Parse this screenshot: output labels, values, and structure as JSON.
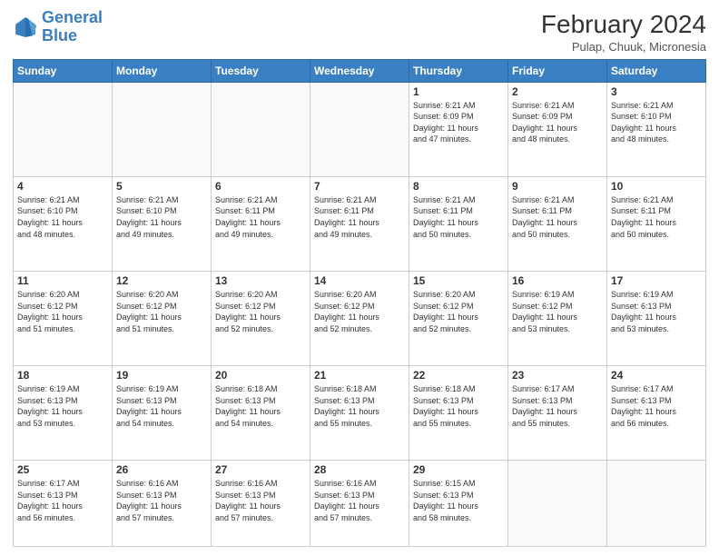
{
  "header": {
    "logo_line1": "General",
    "logo_line2": "Blue",
    "month": "February 2024",
    "location": "Pulap, Chuuk, Micronesia"
  },
  "weekdays": [
    "Sunday",
    "Monday",
    "Tuesday",
    "Wednesday",
    "Thursday",
    "Friday",
    "Saturday"
  ],
  "weeks": [
    [
      {
        "day": "",
        "info": ""
      },
      {
        "day": "",
        "info": ""
      },
      {
        "day": "",
        "info": ""
      },
      {
        "day": "",
        "info": ""
      },
      {
        "day": "1",
        "info": "Sunrise: 6:21 AM\nSunset: 6:09 PM\nDaylight: 11 hours\nand 47 minutes."
      },
      {
        "day": "2",
        "info": "Sunrise: 6:21 AM\nSunset: 6:09 PM\nDaylight: 11 hours\nand 48 minutes."
      },
      {
        "day": "3",
        "info": "Sunrise: 6:21 AM\nSunset: 6:10 PM\nDaylight: 11 hours\nand 48 minutes."
      }
    ],
    [
      {
        "day": "4",
        "info": "Sunrise: 6:21 AM\nSunset: 6:10 PM\nDaylight: 11 hours\nand 48 minutes."
      },
      {
        "day": "5",
        "info": "Sunrise: 6:21 AM\nSunset: 6:10 PM\nDaylight: 11 hours\nand 49 minutes."
      },
      {
        "day": "6",
        "info": "Sunrise: 6:21 AM\nSunset: 6:11 PM\nDaylight: 11 hours\nand 49 minutes."
      },
      {
        "day": "7",
        "info": "Sunrise: 6:21 AM\nSunset: 6:11 PM\nDaylight: 11 hours\nand 49 minutes."
      },
      {
        "day": "8",
        "info": "Sunrise: 6:21 AM\nSunset: 6:11 PM\nDaylight: 11 hours\nand 50 minutes."
      },
      {
        "day": "9",
        "info": "Sunrise: 6:21 AM\nSunset: 6:11 PM\nDaylight: 11 hours\nand 50 minutes."
      },
      {
        "day": "10",
        "info": "Sunrise: 6:21 AM\nSunset: 6:11 PM\nDaylight: 11 hours\nand 50 minutes."
      }
    ],
    [
      {
        "day": "11",
        "info": "Sunrise: 6:20 AM\nSunset: 6:12 PM\nDaylight: 11 hours\nand 51 minutes."
      },
      {
        "day": "12",
        "info": "Sunrise: 6:20 AM\nSunset: 6:12 PM\nDaylight: 11 hours\nand 51 minutes."
      },
      {
        "day": "13",
        "info": "Sunrise: 6:20 AM\nSunset: 6:12 PM\nDaylight: 11 hours\nand 52 minutes."
      },
      {
        "day": "14",
        "info": "Sunrise: 6:20 AM\nSunset: 6:12 PM\nDaylight: 11 hours\nand 52 minutes."
      },
      {
        "day": "15",
        "info": "Sunrise: 6:20 AM\nSunset: 6:12 PM\nDaylight: 11 hours\nand 52 minutes."
      },
      {
        "day": "16",
        "info": "Sunrise: 6:19 AM\nSunset: 6:12 PM\nDaylight: 11 hours\nand 53 minutes."
      },
      {
        "day": "17",
        "info": "Sunrise: 6:19 AM\nSunset: 6:13 PM\nDaylight: 11 hours\nand 53 minutes."
      }
    ],
    [
      {
        "day": "18",
        "info": "Sunrise: 6:19 AM\nSunset: 6:13 PM\nDaylight: 11 hours\nand 53 minutes."
      },
      {
        "day": "19",
        "info": "Sunrise: 6:19 AM\nSunset: 6:13 PM\nDaylight: 11 hours\nand 54 minutes."
      },
      {
        "day": "20",
        "info": "Sunrise: 6:18 AM\nSunset: 6:13 PM\nDaylight: 11 hours\nand 54 minutes."
      },
      {
        "day": "21",
        "info": "Sunrise: 6:18 AM\nSunset: 6:13 PM\nDaylight: 11 hours\nand 55 minutes."
      },
      {
        "day": "22",
        "info": "Sunrise: 6:18 AM\nSunset: 6:13 PM\nDaylight: 11 hours\nand 55 minutes."
      },
      {
        "day": "23",
        "info": "Sunrise: 6:17 AM\nSunset: 6:13 PM\nDaylight: 11 hours\nand 55 minutes."
      },
      {
        "day": "24",
        "info": "Sunrise: 6:17 AM\nSunset: 6:13 PM\nDaylight: 11 hours\nand 56 minutes."
      }
    ],
    [
      {
        "day": "25",
        "info": "Sunrise: 6:17 AM\nSunset: 6:13 PM\nDaylight: 11 hours\nand 56 minutes."
      },
      {
        "day": "26",
        "info": "Sunrise: 6:16 AM\nSunset: 6:13 PM\nDaylight: 11 hours\nand 57 minutes."
      },
      {
        "day": "27",
        "info": "Sunrise: 6:16 AM\nSunset: 6:13 PM\nDaylight: 11 hours\nand 57 minutes."
      },
      {
        "day": "28",
        "info": "Sunrise: 6:16 AM\nSunset: 6:13 PM\nDaylight: 11 hours\nand 57 minutes."
      },
      {
        "day": "29",
        "info": "Sunrise: 6:15 AM\nSunset: 6:13 PM\nDaylight: 11 hours\nand 58 minutes."
      },
      {
        "day": "",
        "info": ""
      },
      {
        "day": "",
        "info": ""
      }
    ]
  ]
}
